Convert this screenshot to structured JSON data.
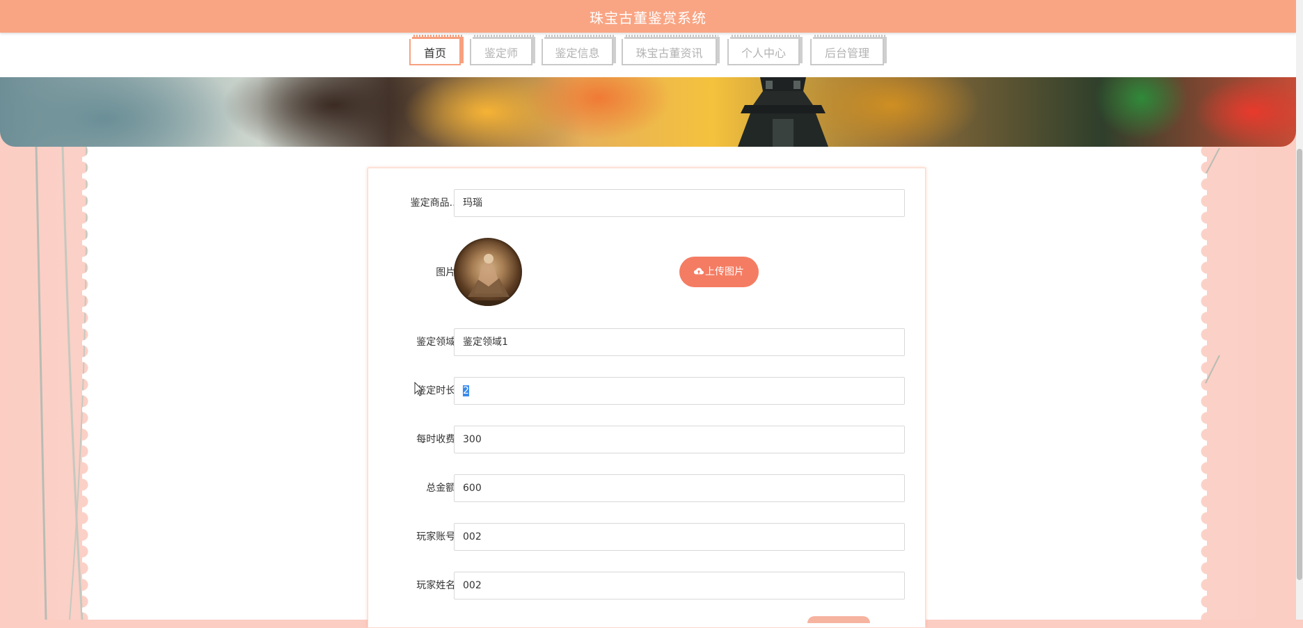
{
  "app": {
    "title": "珠宝古董鉴赏系统"
  },
  "nav": {
    "tabs": [
      {
        "label": "首页",
        "active": true
      },
      {
        "label": "鉴定师",
        "active": false
      },
      {
        "label": "鉴定信息",
        "active": false
      },
      {
        "label": "珠宝古董资讯",
        "active": false
      },
      {
        "label": "个人中心",
        "active": false
      },
      {
        "label": "后台管理",
        "active": false
      }
    ]
  },
  "form": {
    "product": {
      "label": "鉴定商品...",
      "value": "玛瑙"
    },
    "image": {
      "label": "图片:",
      "upload_label": "上传图片",
      "upload_icon": "cloud-upload-icon"
    },
    "field": {
      "label": "鉴定领域:",
      "value": "鉴定领域1"
    },
    "duration": {
      "label": "鉴定时长:",
      "value": "2"
    },
    "hourly_fee": {
      "label": "每时收费:",
      "value": "300"
    },
    "total": {
      "label": "总金额:",
      "value": "600"
    },
    "player_account": {
      "label": "玩家账号:",
      "value": "002"
    },
    "player_name": {
      "label": "玩家姓名:",
      "value": "002"
    }
  },
  "colors": {
    "header": "#f9a584",
    "accent": "#f47c63",
    "tab_active_border": "#f7a07e",
    "tab_inactive_border": "#c9c9c9",
    "page_background": "#fbcdc3"
  }
}
